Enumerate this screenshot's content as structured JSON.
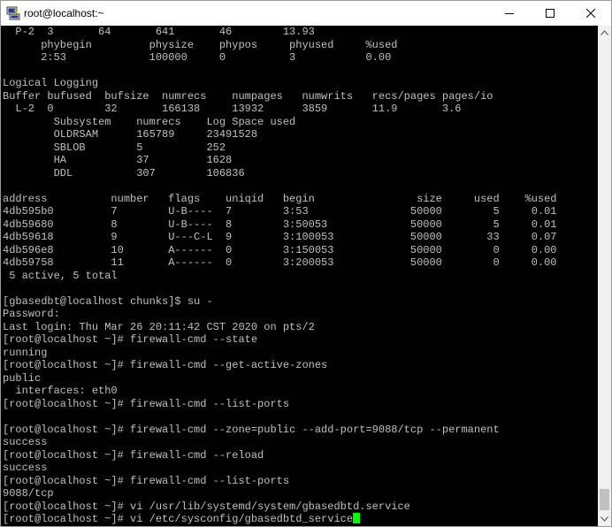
{
  "window": {
    "title": "root@localhost:~",
    "app_icon": "putty-icon",
    "controls": [
      "minimize-icon",
      "maximize-icon",
      "close-icon"
    ]
  },
  "terminal": {
    "lines": [
      "  P-2  3       64       641       46        13.93",
      "      phybegin         physize    phypos     phyused     %used",
      "      2:53             100000     0          3           0.00",
      "",
      "Logical Logging",
      "Buffer bufused  bufsize  numrecs    numpages   numwrits   recs/pages pages/io",
      "  L-2  0        32       166138     13932      3859       11.9       3.6",
      "        Subsystem    numrecs    Log Space used",
      "        OLDRSAM      165789     23491528",
      "        SBLOB        5          252",
      "        HA           37         1628",
      "        DDL          307        106836",
      "",
      "address          number   flags    uniqid   begin                size     used    %used",
      "4db595b0         7        U-B----  7        3:53                50000        5     0.01",
      "4db59680         8        U-B----  8        3:50053             50000        5     0.01",
      "4db59618         9        U---C-L  9        3:100053            50000       33     0.07",
      "4db596e8         10       A------  0        3:150053            50000        0     0.00",
      "4db59758         11       A------  0        3:200053            50000        0     0.00",
      " 5 active, 5 total",
      "",
      "[gbasedbt@localhost chunks]$ su -",
      "Password:",
      "Last login: Thu Mar 26 20:11:42 CST 2020 on pts/2",
      "[root@localhost ~]# firewall-cmd --state",
      "running",
      "[root@localhost ~]# firewall-cmd --get-active-zones",
      "public",
      "  interfaces: eth0",
      "[root@localhost ~]# firewall-cmd --list-ports",
      "",
      "[root@localhost ~]# firewall-cmd --zone=public --add-port=9088/tcp --permanent",
      "success",
      "[root@localhost ~]# firewall-cmd --reload",
      "success",
      "[root@localhost ~]# firewall-cmd --list-ports",
      "9088/tcp",
      "[root@localhost ~]# vi /usr/lib/systemd/system/gbasedbtd.service",
      "[root@localhost ~]# vi /etc/sysconfig/gbasedbtd_service"
    ],
    "text_color": "#c0c0c0",
    "background": "#000000",
    "cursor_color": "#00ff00"
  }
}
